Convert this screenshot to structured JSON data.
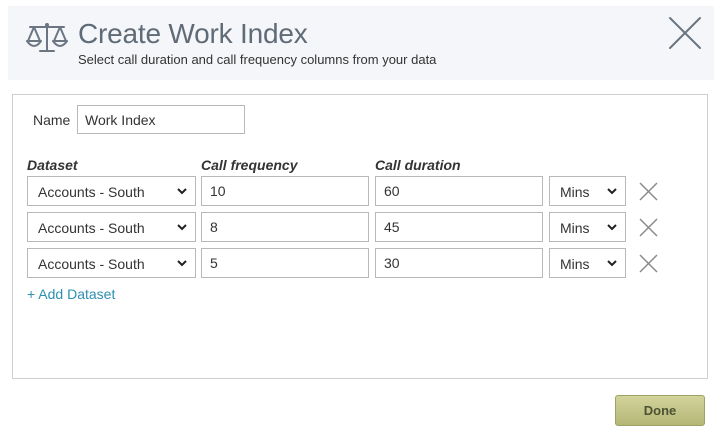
{
  "dialog": {
    "title": "Create Work Index",
    "subtitle": "Select call duration and call frequency columns from your data"
  },
  "form": {
    "name_label": "Name",
    "name_value": "Work Index",
    "columns": {
      "dataset": "Dataset",
      "frequency": "Call frequency",
      "duration": "Call duration"
    },
    "rows": [
      {
        "dataset": "Accounts - South",
        "frequency": "10",
        "duration": "60",
        "unit": "Mins"
      },
      {
        "dataset": "Accounts - South",
        "frequency": "8",
        "duration": "45",
        "unit": "Mins"
      },
      {
        "dataset": "Accounts - South",
        "frequency": "5",
        "duration": "30",
        "unit": "Mins"
      }
    ],
    "add_link": "+ Add Dataset"
  },
  "footer": {
    "done_label": "Done"
  },
  "icons": {
    "header": "scale-icon",
    "close": "close-icon",
    "remove": "close-icon",
    "dropdown": "chevron-down-icon"
  },
  "colors": {
    "title": "#5f6b77",
    "header_bg": "#f4f6f9",
    "link": "#2e8fb0",
    "done_button": "#c4c78a"
  }
}
